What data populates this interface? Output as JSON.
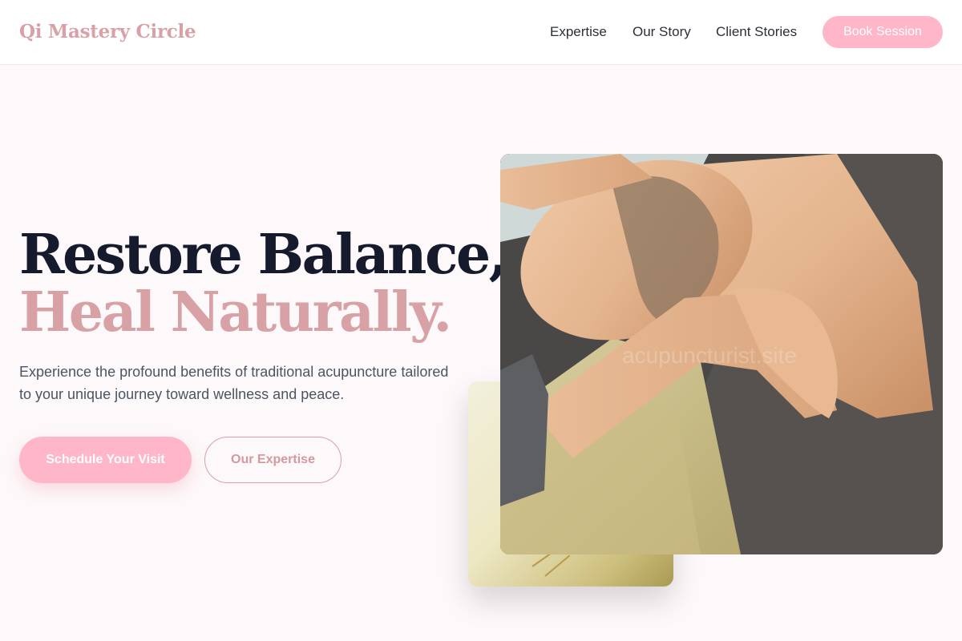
{
  "header": {
    "brand": "Qi Mastery Circle",
    "nav": [
      "Expertise",
      "Our Story",
      "Client Stories"
    ],
    "cta": "Book Session"
  },
  "hero": {
    "headline_line1": "Restore Balance,",
    "headline_line2": "Heal Naturally.",
    "subtext": "Experience the profound benefits of traditional acupuncture tailored to your unique journey toward wellness and peace.",
    "primary_button": "Schedule Your Visit",
    "secondary_button": "Our Expertise"
  },
  "images": {
    "main_photo_alt": "Man receiving neck and shoulder massage",
    "secondary_photo_alt": "Acupuncture needles on towel",
    "watermark": "acupuncturist.site"
  },
  "colors": {
    "accent_pink": "#ffb6c8",
    "brand_rose": "#d8a1a6",
    "headline_dark": "#151a2d",
    "page_background": "#fdf8f9"
  }
}
